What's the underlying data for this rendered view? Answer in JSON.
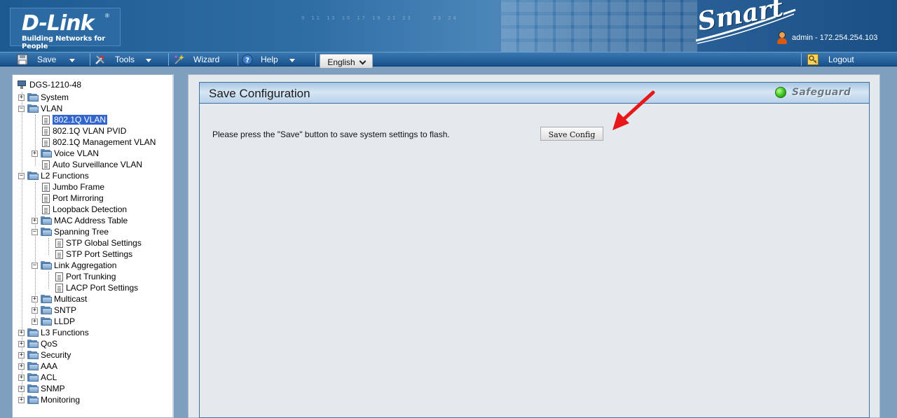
{
  "header": {
    "logo": "D-Link",
    "logo_tagline": "Building Networks for People",
    "brand_script": "Smart",
    "user_info": "admin - 172.254.254.103"
  },
  "toolbar": {
    "save_label": "Save",
    "tools_label": "Tools",
    "wizard_label": "Wizard",
    "help_label": "Help",
    "language": "English",
    "logout_label": "Logout"
  },
  "tree": {
    "root": "DGS-1210-48",
    "items": [
      {
        "label": "System"
      },
      {
        "label": "VLAN"
      },
      {
        "label": "802.1Q VLAN",
        "selected": true
      },
      {
        "label": "802.1Q VLAN PVID"
      },
      {
        "label": "802.1Q Management VLAN"
      },
      {
        "label": "Voice VLAN"
      },
      {
        "label": "Auto Surveillance VLAN"
      },
      {
        "label": "L2 Functions"
      },
      {
        "label": "Jumbo Frame"
      },
      {
        "label": "Port Mirroring"
      },
      {
        "label": "Loopback Detection"
      },
      {
        "label": "MAC Address Table"
      },
      {
        "label": "Spanning Tree"
      },
      {
        "label": "STP Global Settings"
      },
      {
        "label": "STP Port Settings"
      },
      {
        "label": "Link Aggregation"
      },
      {
        "label": "Port Trunking"
      },
      {
        "label": "LACP Port Settings"
      },
      {
        "label": "Multicast"
      },
      {
        "label": "SNTP"
      },
      {
        "label": "LLDP"
      },
      {
        "label": "L3 Functions"
      },
      {
        "label": "QoS"
      },
      {
        "label": "Security"
      },
      {
        "label": "AAA"
      },
      {
        "label": "ACL"
      },
      {
        "label": "SNMP"
      },
      {
        "label": "Monitoring"
      }
    ]
  },
  "main": {
    "title": "Save Configuration",
    "safeguard_label": "Safeguard",
    "description": "Please press the \"Save\" button to save system settings to flash.",
    "save_button_label": "Save Config"
  },
  "colors": {
    "header_blue": "#2f6ea5",
    "selected_blue": "#3366cc",
    "safeguard_green": "#35c21e",
    "annotation_red": "#e8181a"
  }
}
